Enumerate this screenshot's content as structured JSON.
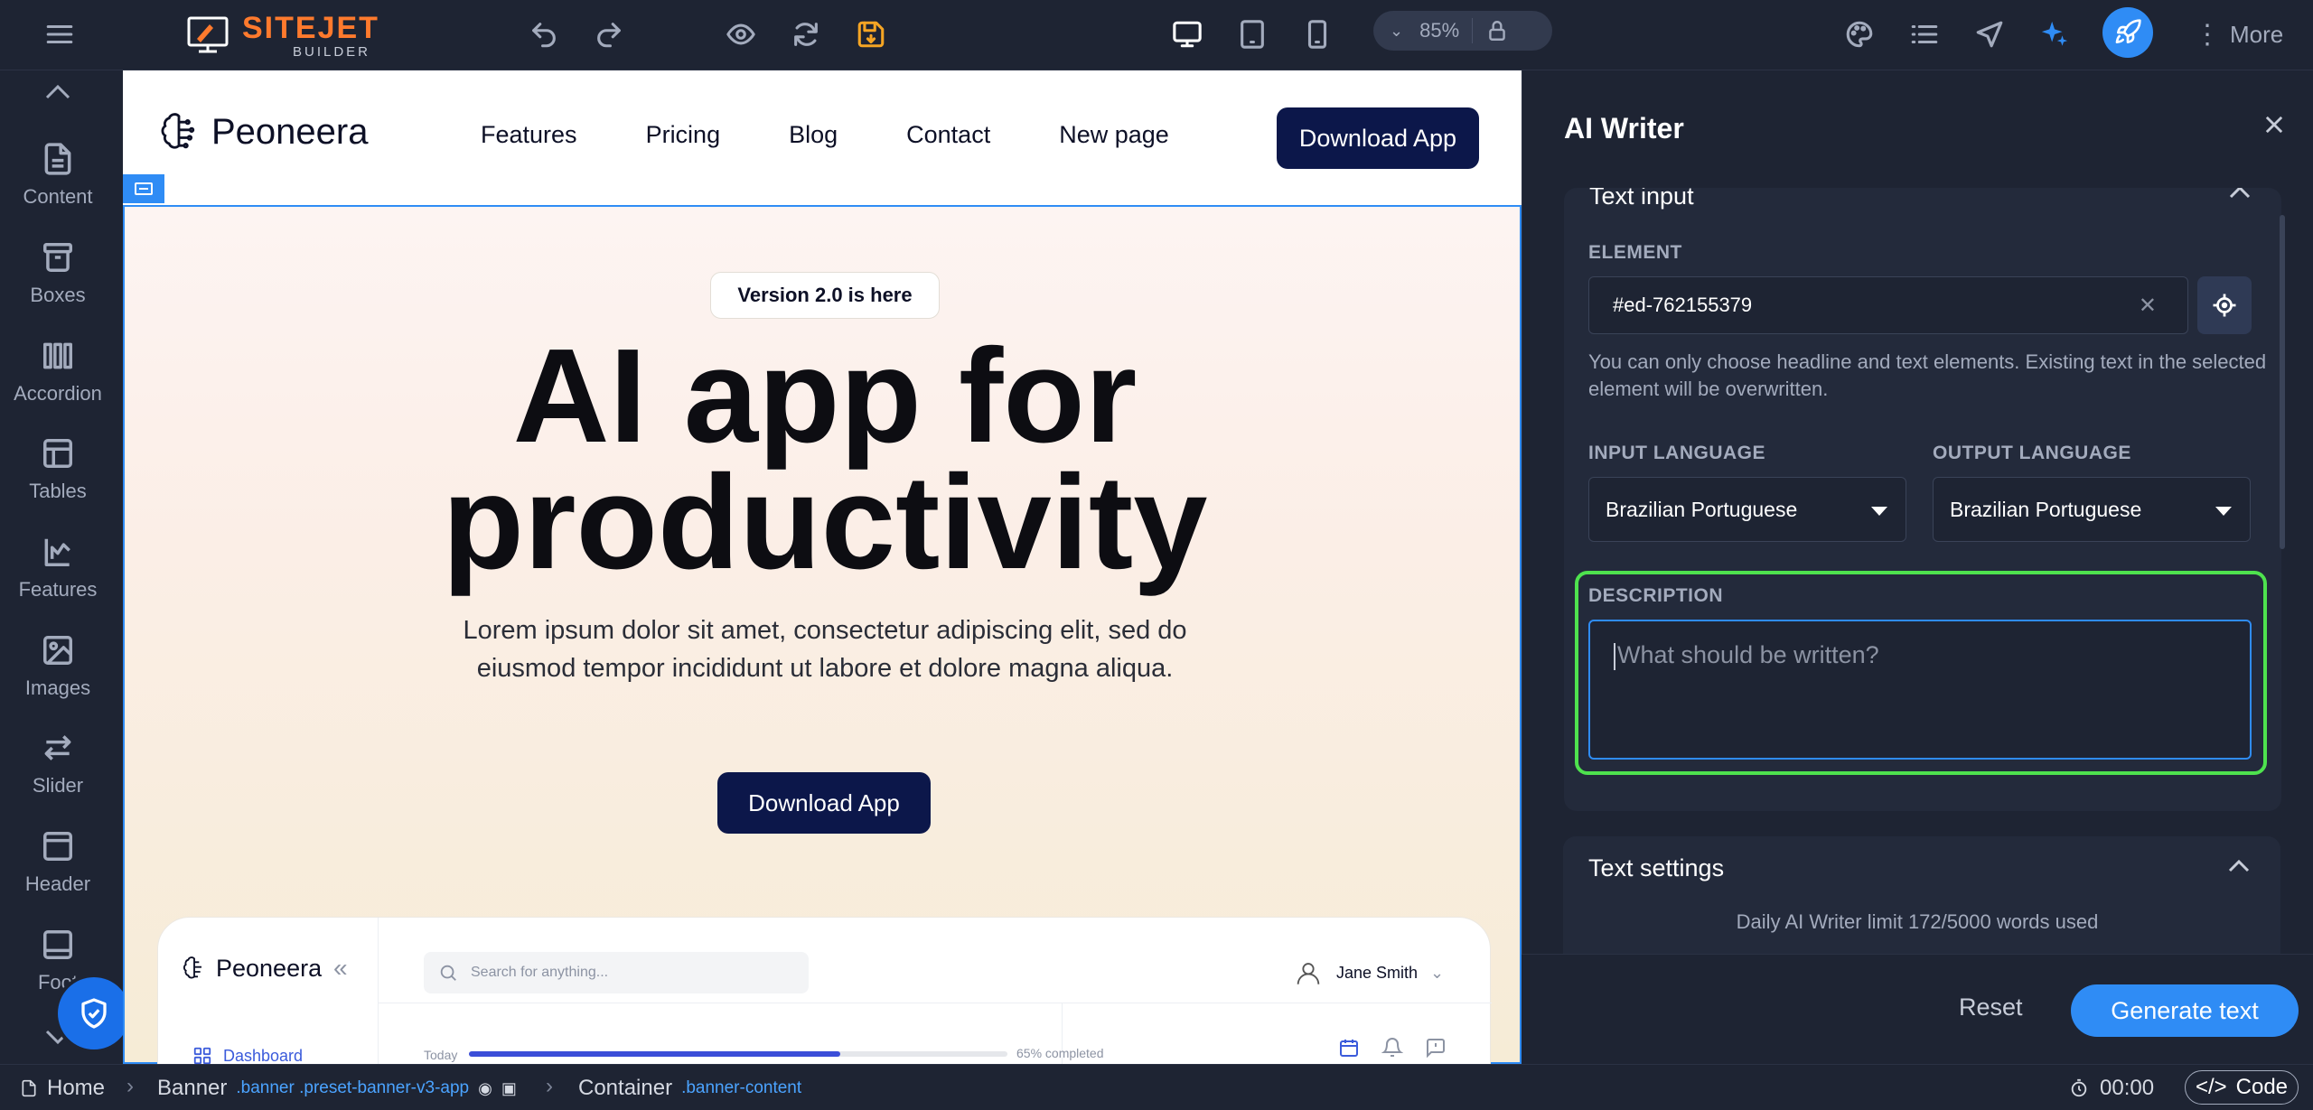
{
  "toolbar": {
    "logo_main": "SITEJET",
    "logo_sub": "BUILDER",
    "zoom_value": "85%",
    "more_label": "More"
  },
  "sidebar": {
    "items": [
      {
        "label": "Content",
        "icon": "file-icon"
      },
      {
        "label": "Boxes",
        "icon": "archive-icon"
      },
      {
        "label": "Accordion",
        "icon": "accordion-icon"
      },
      {
        "label": "Tables",
        "icon": "table-icon"
      },
      {
        "label": "Features",
        "icon": "features-icon"
      },
      {
        "label": "Images",
        "icon": "image-icon"
      },
      {
        "label": "Slider",
        "icon": "swap-arrows-icon"
      },
      {
        "label": "Header",
        "icon": "header-layout-icon"
      },
      {
        "label": "Foot",
        "icon": "footer-layout-icon"
      }
    ]
  },
  "site": {
    "brand": "Peoneera",
    "nav_links": [
      "Features",
      "Pricing",
      "Blog",
      "Contact",
      "New page"
    ],
    "nav_cta": "Download App",
    "badge": "Version 2.0 is here",
    "headline": "AI app for productivity",
    "subtext": "Lorem ipsum dolor sit amet, consectetur adipiscing elit, sed do eiusmod tempor incididunt ut labore et dolore magna aliqua.",
    "hero_cta": "Download App",
    "mockup": {
      "brand": "Peoneera",
      "search_placeholder": "Search for anything...",
      "user_name": "Jane Smith",
      "menu_item": "Dashboard",
      "today_label": "Today",
      "progress_label": "65% completed",
      "progress_fraction": 0.69
    }
  },
  "breadcrumb": {
    "home": "Home",
    "banner": "Banner",
    "banner_classes": ".banner .preset-banner-v3-app",
    "container": "Container",
    "container_class": ".banner-content",
    "timer": "00:00",
    "code_label": "Code"
  },
  "ai_writer": {
    "title": "AI Writer",
    "section_title": "Text input",
    "element_label": "ELEMENT",
    "element_value": "#ed-762155379",
    "element_help": "You can only choose headline and text elements. Existing text in the selected element will be overwritten.",
    "input_language_label": "INPUT LANGUAGE",
    "input_language_value": "Brazilian Portuguese",
    "output_language_label": "OUTPUT LANGUAGE",
    "output_language_value": "Brazilian Portuguese",
    "description_label": "DESCRIPTION",
    "description_placeholder": "What should be written?",
    "text_settings_label": "Text settings",
    "limit_text": "Daily AI Writer limit 172/5000 words used",
    "reset_label": "Reset",
    "generate_label": "Generate text"
  },
  "colors": {
    "accent": "#2f8cf5",
    "brand_orange": "#ff7a2d",
    "highlight_green": "#4ee24e",
    "site_navy": "#0c174a"
  }
}
